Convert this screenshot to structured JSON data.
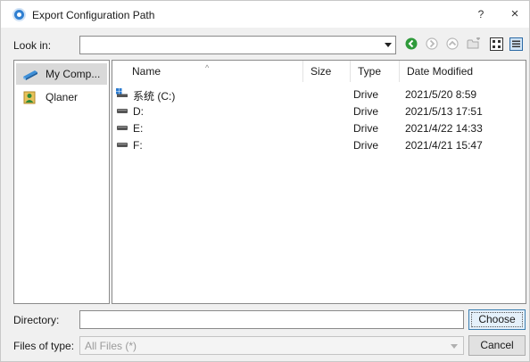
{
  "window": {
    "title": "Export Configuration Path",
    "help_label": "?",
    "close_label": "×"
  },
  "look_in": {
    "label": "Look in:",
    "value": ""
  },
  "toolbar": {
    "buttons": [
      "back-icon",
      "forward-icon",
      "parent-folder-icon",
      "new-folder-icon",
      "list-view-icon",
      "detail-view-icon"
    ],
    "accent_color": "#2e9a3a"
  },
  "sidebar": {
    "items": [
      {
        "label": "My Comp...",
        "icon": "computer-icon",
        "selected": true
      },
      {
        "label": "Qlaner",
        "icon": "user-folder-icon",
        "selected": false
      }
    ]
  },
  "files": {
    "columns": [
      "Name",
      "Size",
      "Type",
      "Date Modified"
    ],
    "rows": [
      {
        "name": "系统 (C:)",
        "size": "",
        "type": "Drive",
        "date": "2021/5/20 8:59",
        "icon": "system-drive-icon"
      },
      {
        "name": "D:",
        "size": "",
        "type": "Drive",
        "date": "2021/5/13 17:51",
        "icon": "drive-icon"
      },
      {
        "name": "E:",
        "size": "",
        "type": "Drive",
        "date": "2021/4/22 14:33",
        "icon": "drive-icon"
      },
      {
        "name": "F:",
        "size": "",
        "type": "Drive",
        "date": "2021/4/21 15:47",
        "icon": "drive-icon"
      }
    ]
  },
  "directory": {
    "label": "Directory:",
    "value": "",
    "choose_label": "Choose"
  },
  "file_type": {
    "label": "Files of type:",
    "value": "All Files (*)",
    "cancel_label": "Cancel"
  }
}
